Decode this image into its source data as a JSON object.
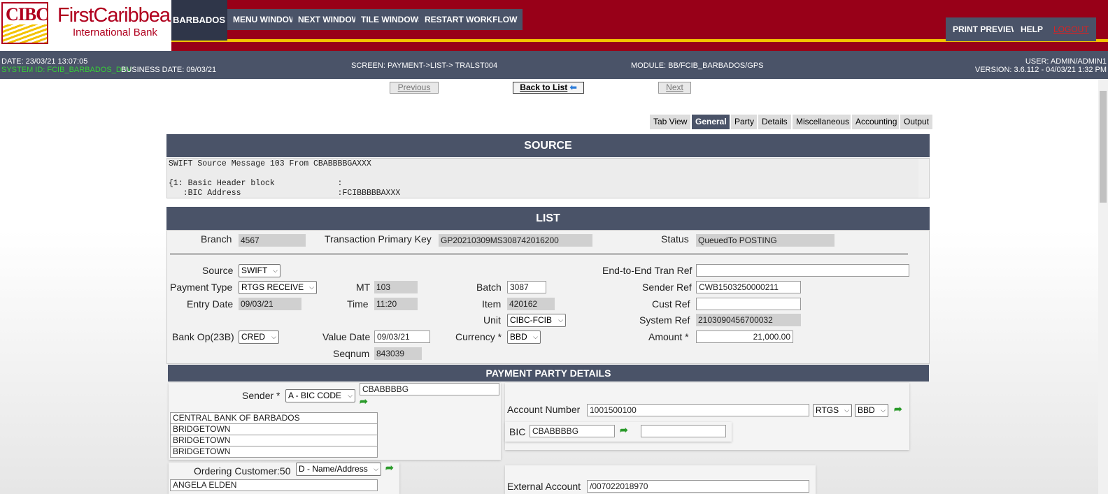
{
  "brand": {
    "mark": "CIBC",
    "name": "FirstCaribbean",
    "sub": "International Bank"
  },
  "topnav": {
    "region": "BARBADOS",
    "items": [
      "MENU WINDOW",
      "NEXT WINDOW",
      "TILE WINDOWS",
      "RESTART WORKFLOW"
    ]
  },
  "rightnav": {
    "print": "PRINT PREVIEW",
    "help": "HELP",
    "logout": "LOGOUT"
  },
  "info": {
    "date": "DATE: 23/03/21 13:07:05",
    "system_id": "SYSTEM ID: FCIB_BARBADOS_DEV",
    "business_date": "BUSINESS DATE: 09/03/21",
    "screen": "SCREEN: PAYMENT->LIST-> TRALST004",
    "module": "MODULE: BB/FCIB_BARBADOS/GPS",
    "user": "USER: ADMIN/ADMIN1",
    "version": "VERSION: 3.6.112 - 04/03/21 1:32 PM"
  },
  "nav": {
    "previous": "Previous",
    "back": "Back to List",
    "next": "Next"
  },
  "tabs": [
    "Tab View",
    "General",
    "Party",
    "Details",
    "Miscellaneous",
    "Accounting",
    "Output"
  ],
  "source": {
    "title": "SOURCE",
    "text": "SWIFT Source Message 103 From CBABBBBGAXXX\n\n{1: Basic Header block             :\n   :BIC Address                    :FCIBBBBBAXXX"
  },
  "list": {
    "title": "LIST",
    "branch_label": "Branch",
    "branch": "4567",
    "tpk_label": "Transaction Primary Key",
    "tpk": "GP20210309MS308742016200",
    "status_label": "Status",
    "status": "QueuedTo POSTING",
    "source_label": "Source",
    "source": "SWIFT",
    "ptype_label": "Payment Type",
    "ptype": "RTGS RECEIVE",
    "entry_label": "Entry Date",
    "entry": "09/03/21",
    "bankop_label": "Bank Op(23B)",
    "bankop": "CRED",
    "mt_label": "MT",
    "mt": "103",
    "time_label": "Time",
    "time": "11:20",
    "value_label": "Value Date",
    "value": "09/03/21",
    "seq_label": "Seqnum",
    "seq": "843039",
    "batch_label": "Batch",
    "batch": "3087",
    "item_label": "Item",
    "item": "420162",
    "unit_label": "Unit",
    "unit": "CIBC-FCIB",
    "currency_label": "Currency *",
    "currency": "BBD",
    "e2e_label": "End-to-End Tran Ref",
    "e2e": "",
    "sref_label": "Sender Ref",
    "sref": "CWB1503250000211",
    "cref_label": "Cust Ref",
    "cref": "",
    "sys_label": "System Ref",
    "sys": "2103090456700032",
    "amount_label": "Amount *",
    "amount": "21,000.00"
  },
  "party": {
    "title": "PAYMENT PARTY DETAILS",
    "sender_label": "Sender *",
    "sender_type": "A - BIC CODE",
    "sender_bic": "CBABBBBG",
    "sender_lines": [
      "CENTRAL BANK OF BARBADOS",
      "BRIDGETOWN",
      "BRIDGETOWN",
      "BRIDGETOWN"
    ],
    "acct_label": "Account Number",
    "acct": "1001500100",
    "acct_type": "RTGS",
    "acct_ccy": "BBD",
    "bic_label": "BIC",
    "bic": "CBABBBBG",
    "bic2": "",
    "ordering_label": "Ordering Customer:50",
    "ordering_type": "D - Name/Address",
    "ordering_name": "ANGELA ELDEN",
    "ext_label": "External Account",
    "ext": "/007022018970"
  }
}
